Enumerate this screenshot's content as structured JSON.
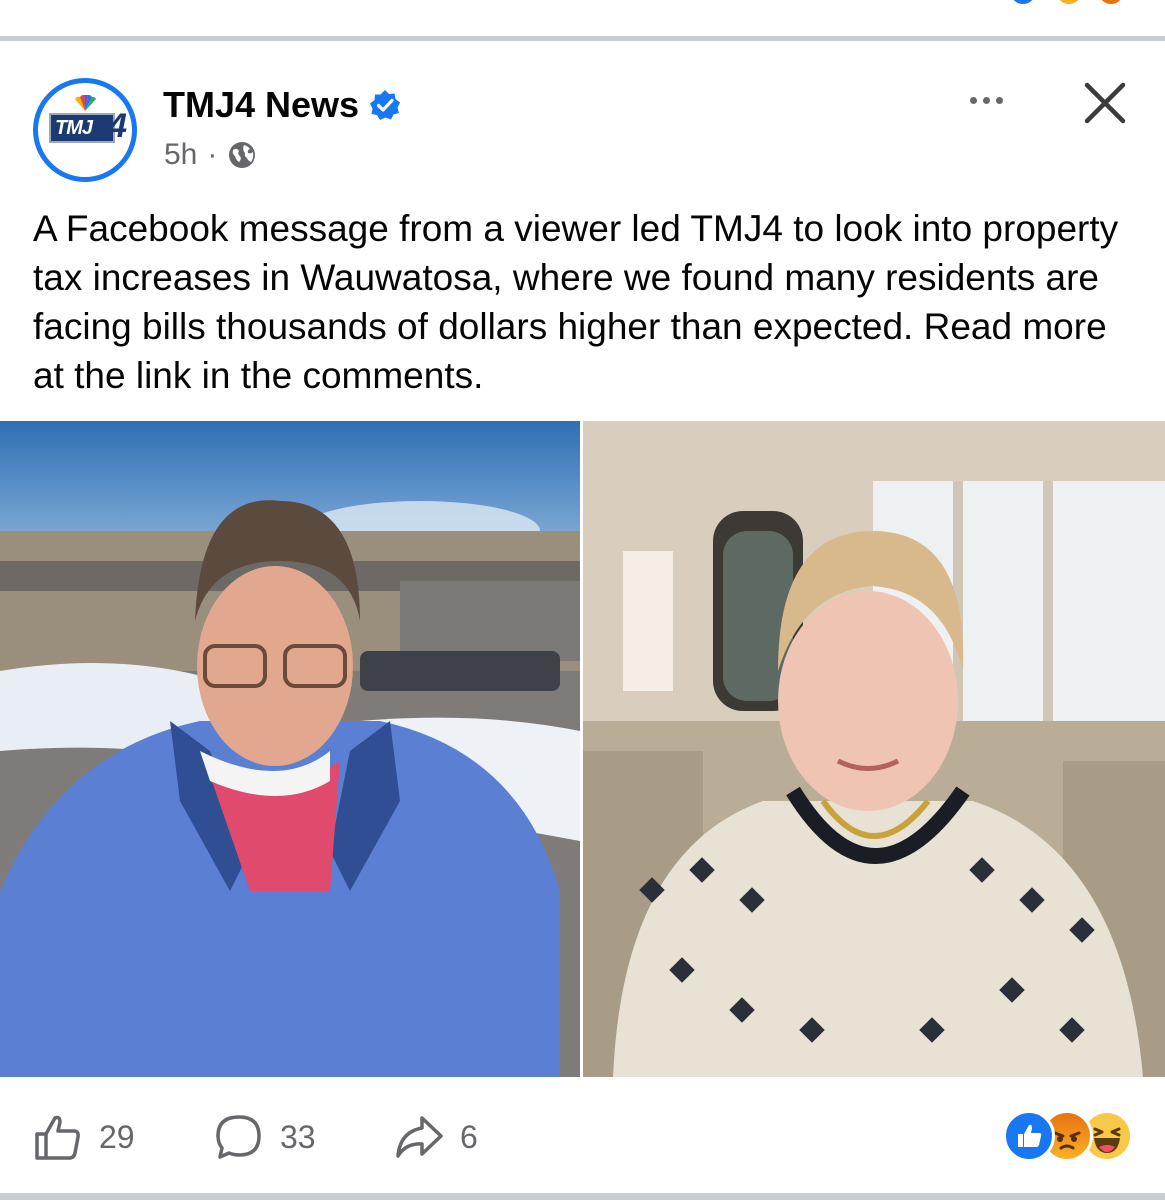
{
  "post": {
    "page_name": "TMJ4 News",
    "timestamp": "5h",
    "separator": "·",
    "audience_icon": "globe-icon",
    "verified_icon": "verified-badge-icon",
    "avatar_logo_text": "TMJ",
    "avatar_logo_number": "4",
    "text": "A Facebook message from a viewer led TMJ4 to look into property tax increases in Wauwatosa, where we found many residents are facing bills thousands of dollars higher than expected. Read more at the link in the comments.",
    "photos": [
      {
        "icon": "photo-woman-outdoors"
      },
      {
        "icon": "photo-woman-indoors"
      }
    ]
  },
  "actions": {
    "like_count": "29",
    "comment_count": "33",
    "share_count": "6",
    "reaction_icons": [
      "like-reaction-icon",
      "angry-reaction-icon",
      "haha-reaction-icon"
    ]
  },
  "colors": {
    "accent": "#1877f2",
    "secondary_text": "#65676b",
    "divider": "#c9ccd1"
  }
}
